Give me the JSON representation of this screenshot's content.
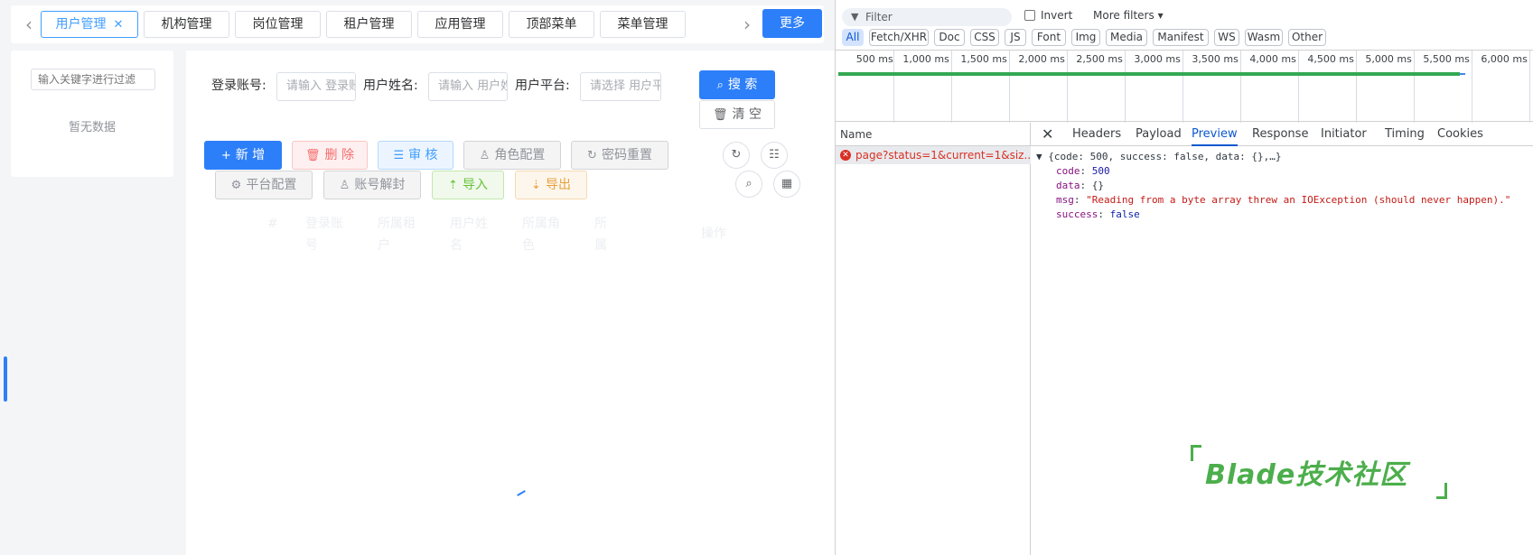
{
  "tabs": {
    "items": [
      "用户管理",
      "机构管理",
      "岗位管理",
      "租户管理",
      "应用管理",
      "顶部菜单",
      "菜单管理"
    ],
    "active_index": 0,
    "more_label": "更多"
  },
  "tree": {
    "filter_placeholder": "输入关键字进行过滤",
    "empty_text": "暂无数据"
  },
  "search_form": {
    "account_label": "登录账号:",
    "account_placeholder": "请输入 登录账号",
    "username_label": "用户姓名:",
    "username_placeholder": "请输入 用户姓名",
    "platform_label": "用户平台:",
    "platform_placeholder": "请选择 用户平台",
    "search_label": "搜 索",
    "clear_label": "清 空"
  },
  "toolbar": {
    "add": "新 增",
    "delete": "删 除",
    "audit": "审 核",
    "role_config": "角色配置",
    "password_reset": "密码重置",
    "platform_config": "平台配置",
    "account_unlock": "账号解封",
    "import": "导入",
    "export": "导出"
  },
  "table": {
    "headers": [
      "#",
      "登录账号",
      "所属租户",
      "用户姓名",
      "所属角色",
      "所属部门",
      "操作"
    ]
  },
  "devtools": {
    "filter_placeholder": "Filter",
    "invert_label": "Invert",
    "more_filters_label": "More filters",
    "type_filters": [
      "All",
      "Fetch/XHR",
      "Doc",
      "CSS",
      "JS",
      "Font",
      "Img",
      "Media",
      "Manifest",
      "WS",
      "Wasm",
      "Other"
    ],
    "timeline_ticks": [
      "500 ms",
      "1,000 ms",
      "1,500 ms",
      "2,000 ms",
      "2,500 ms",
      "3,000 ms",
      "3,500 ms",
      "4,000 ms",
      "4,500 ms",
      "5,000 ms",
      "5,500 ms",
      "6,000 ms"
    ],
    "name_column": "Name",
    "request_name": "page?status=1&current=1&siz...",
    "detail_tabs": [
      "Headers",
      "Payload",
      "Preview",
      "Response",
      "Initiator",
      "Timing",
      "Cookies"
    ],
    "active_detail_tab": "Preview",
    "preview": {
      "summary": "{code: 500, success: false, data: {},…}",
      "code_key": "code",
      "code_value": "500",
      "data_key": "data",
      "data_value": "{}",
      "msg_key": "msg",
      "msg_value": "\"Reading from a byte array threw an IOException (should never happen).\"",
      "success_key": "success",
      "success_value": "false"
    }
  },
  "colors": {
    "primary": "#2d7ff9",
    "danger": "#f56c6c",
    "success": "#67c23a",
    "warning": "#e6a23c",
    "error_red": "#d93025",
    "watermark_green": "#4cae4c"
  }
}
